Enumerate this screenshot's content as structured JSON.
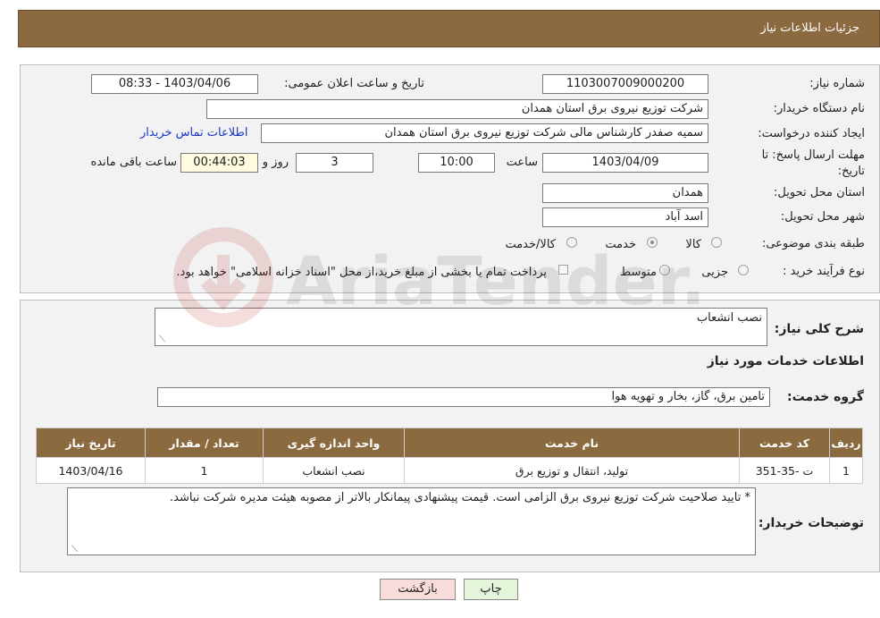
{
  "header": {
    "title": "جزئیات اطلاعات نیاز"
  },
  "fields": {
    "need_number_label": "شماره نیاز:",
    "need_number": "1103007009000200",
    "announce_label": "تاریخ و ساعت اعلان عمومی:",
    "announce_value": "1403/04/06 - 08:33",
    "buyer_org_label": "نام دستگاه خریدار:",
    "buyer_org": "شرکت توزیع نیروی برق استان همدان",
    "creator_label": "ایجاد کننده درخواست:",
    "creator": "سمیه صفدر کارشناس مالی شرکت توزیع نیروی برق استان همدان",
    "contact_link": "اطلاعات تماس خریدار",
    "deadline_label": "مهلت ارسال پاسخ: تا",
    "deadline_label2": "تاریخ:",
    "deadline_date": "1403/04/09",
    "time_label": "ساعت",
    "deadline_time": "10:00",
    "days": "3",
    "days_label": "روز و",
    "remaining": "00:44:03",
    "remaining_label": "ساعت باقی مانده",
    "province_label": "استان محل تحویل:",
    "province": "همدان",
    "city_label": "شهر محل تحویل:",
    "city": "اسد آباد",
    "category_label": "طبقه بندی موضوعی:",
    "category_options": [
      "کالا",
      "خدمت",
      "کالا/خدمت"
    ],
    "category_selected": "خدمت",
    "purchase_type_label": "نوع فرآیند خرید :",
    "purchase_options": [
      "جزیی",
      "متوسط"
    ],
    "payment_note": "پرداخت تمام یا بخشی از مبلغ خرید،از محل \"اسناد خزانه اسلامی\" خواهد بود."
  },
  "general": {
    "desc_label": "شرح کلی نیاز:",
    "desc_value": "نصب انشعاب",
    "services_title": "اطلاعات خدمات مورد نیاز",
    "group_label": "گروه خدمت:",
    "group_value": "تامین برق، گاز، بخار و تهویه هوا"
  },
  "table": {
    "headers": [
      "ردیف",
      "کد خدمت",
      "نام خدمت",
      "واحد اندازه گیری",
      "تعداد / مقدار",
      "تاریخ نیاز"
    ],
    "rows": [
      [
        "1",
        "ت -35-351",
        "تولید، انتقال و توزیع برق",
        "نصب انشعاب",
        "1",
        "1403/04/16"
      ]
    ]
  },
  "notes": {
    "label": "توضیحات خریدار:",
    "value": "* تایید صلاحیت شرکت توزیع نیروی برق الزامی است. قیمت پیشنهادی پیمانکار بالاتر از مصوبه هیئت مدیره شرکت نباشد."
  },
  "buttons": {
    "print": "چاپ",
    "back": "بازگشت"
  },
  "watermark": {
    "text": "AriaTender.neT"
  },
  "colors": {
    "header": "#8b6a3f",
    "link": "#1a37c6",
    "panel": "#f2f2f2"
  }
}
